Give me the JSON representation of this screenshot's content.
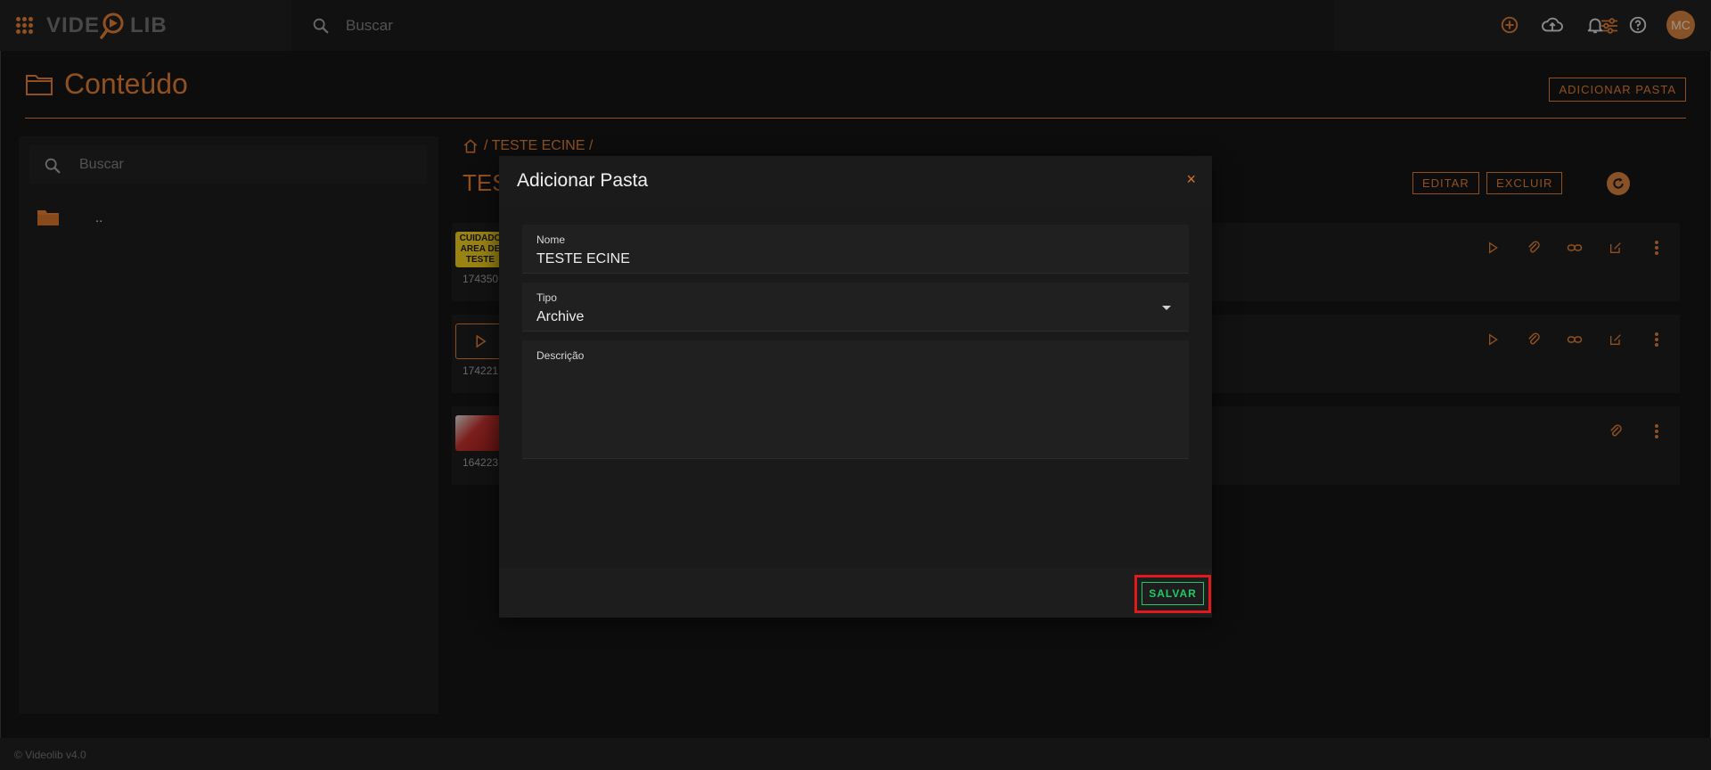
{
  "app": {
    "logo_text_a": "VIDE",
    "logo_text_b": "LIB",
    "search_placeholder": "Buscar",
    "avatar_initials": "MC",
    "brand_color": "#d5772e"
  },
  "page": {
    "title": "Conteúdo",
    "add_folder_label": "ADICIONAR PASTA",
    "breadcrumb": "/ TESTE ECINE /",
    "folder_heading": "TES",
    "edit_label": "EDITAR",
    "delete_label": "EXCLUIR"
  },
  "sidebar": {
    "search_placeholder": "Buscar",
    "folder_label": ".."
  },
  "rows": [
    {
      "id": "174350",
      "thumb_lines": [
        "CUIDADO",
        "AREA DE",
        "TESTE"
      ]
    },
    {
      "id": "174221"
    },
    {
      "id": "164223"
    }
  ],
  "footer": {
    "text": "© Videolib v4.0"
  },
  "dialog": {
    "title": "Adicionar Pasta",
    "close": "×",
    "nome_label": "Nome",
    "nome_value": "TESTE ECINE",
    "tipo_label": "Tipo",
    "tipo_value": "Archive",
    "desc_label": "Descrição",
    "desc_value": "",
    "save_label": "SALVAR",
    "save_color": "#21c86a",
    "highlight_color": "#e0191c"
  }
}
